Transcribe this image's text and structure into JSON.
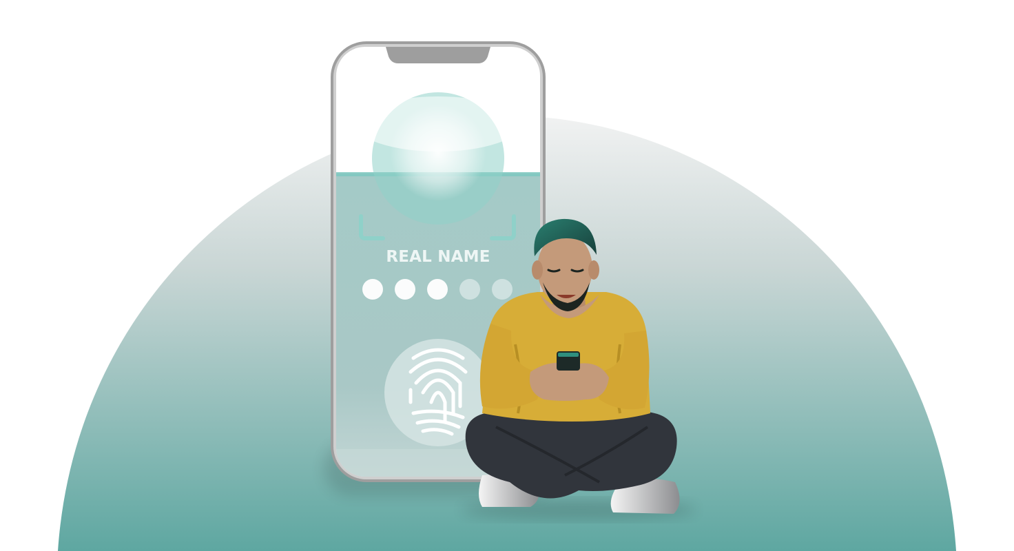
{
  "screen": {
    "title": "REAL NAME",
    "pin_dots_total": 5,
    "pin_dots_filled": 3
  },
  "icons": {
    "fingerprint": "fingerprint-icon",
    "face_scan": "face-scan-icon"
  },
  "colors": {
    "background": "#ffffff",
    "dome_top": "#f1f2f2",
    "dome_bottom": "#5ea7a1",
    "phone_frame": "#a6a6a6",
    "screen_teal": "#9dc3c1",
    "sweater": "#d7ad37",
    "pants": "#31353c",
    "hair": "#1f5f55",
    "skin": "#c49a7a"
  }
}
